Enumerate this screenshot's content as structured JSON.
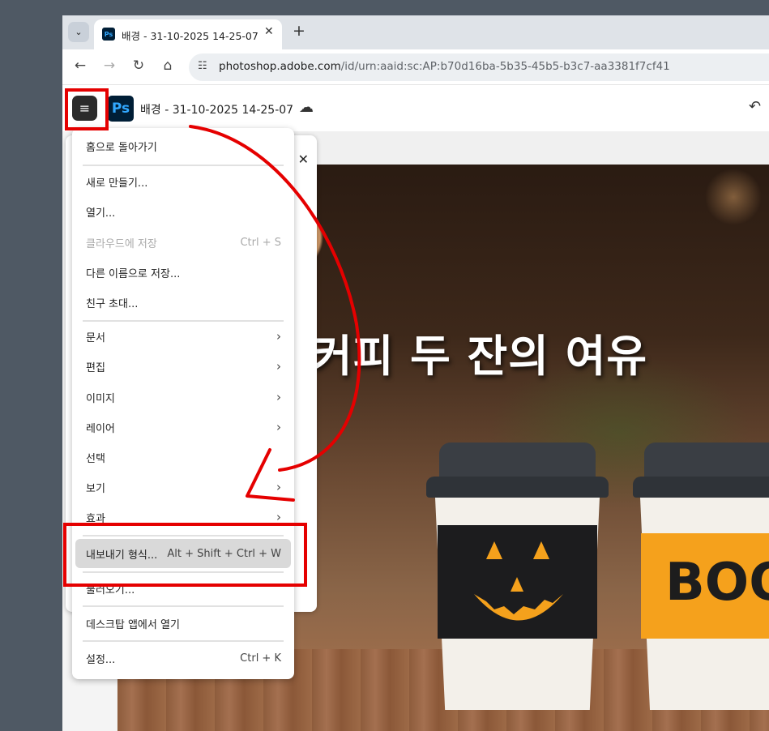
{
  "browser": {
    "tab_title": "배경 - 31-10-2025 14-25-07 -",
    "tab_favicon": "Ps",
    "new_tab": "+",
    "tab_close": "✕",
    "tab_menu": "⌄",
    "url_host": "photoshop.adobe.com",
    "url_path": "/id/urn:aaid:sc:AP:b70d16ba-5b35-45b5-b3c7-aa3381f7cf41"
  },
  "app": {
    "logo": "Ps",
    "doc_title": "배경 - 31-10-2025 14-25-07",
    "menu_icon": "≡"
  },
  "canvas": {
    "headline": "커피 두 잔의 여유",
    "sleeve_text": "BOO"
  },
  "menu": {
    "items": [
      {
        "label": "홈으로 돌아가기",
        "shortcut": "",
        "submenu": false,
        "disabled": false
      },
      {
        "label": "새로 만들기...",
        "shortcut": "",
        "submenu": false,
        "disabled": false
      },
      {
        "label": "열기...",
        "shortcut": "",
        "submenu": false,
        "disabled": false
      },
      {
        "label": "클라우드에 저장",
        "shortcut": "Ctrl + S",
        "submenu": false,
        "disabled": true
      },
      {
        "label": "다른 이름으로 저장...",
        "shortcut": "",
        "submenu": false,
        "disabled": false
      },
      {
        "label": "친구 초대...",
        "shortcut": "",
        "submenu": false,
        "disabled": false
      },
      {
        "label": "문서",
        "shortcut": "",
        "submenu": true,
        "disabled": false
      },
      {
        "label": "편집",
        "shortcut": "",
        "submenu": true,
        "disabled": false
      },
      {
        "label": "이미지",
        "shortcut": "",
        "submenu": true,
        "disabled": false
      },
      {
        "label": "레이어",
        "shortcut": "",
        "submenu": true,
        "disabled": false
      },
      {
        "label": "선택",
        "shortcut": "",
        "submenu": false,
        "disabled": false
      },
      {
        "label": "보기",
        "shortcut": "",
        "submenu": true,
        "disabled": false
      },
      {
        "label": "효과",
        "shortcut": "",
        "submenu": true,
        "disabled": false
      },
      {
        "label": "내보내기 형식...",
        "shortcut": "Alt + Shift + Ctrl + W",
        "submenu": false,
        "disabled": false,
        "active": true
      },
      {
        "label": "불러오기...",
        "shortcut": "",
        "submenu": false,
        "disabled": false
      },
      {
        "label": "데스크탑 앱에서 열기",
        "shortcut": "",
        "submenu": false,
        "disabled": false
      },
      {
        "label": "설정...",
        "shortcut": "Ctrl + K",
        "submenu": false,
        "disabled": false
      }
    ]
  },
  "colors": {
    "annotation": "#e50000",
    "ps_blue": "#31a8ff",
    "ps_dark": "#001e36",
    "sleeve_orange": "#f5a11c"
  }
}
